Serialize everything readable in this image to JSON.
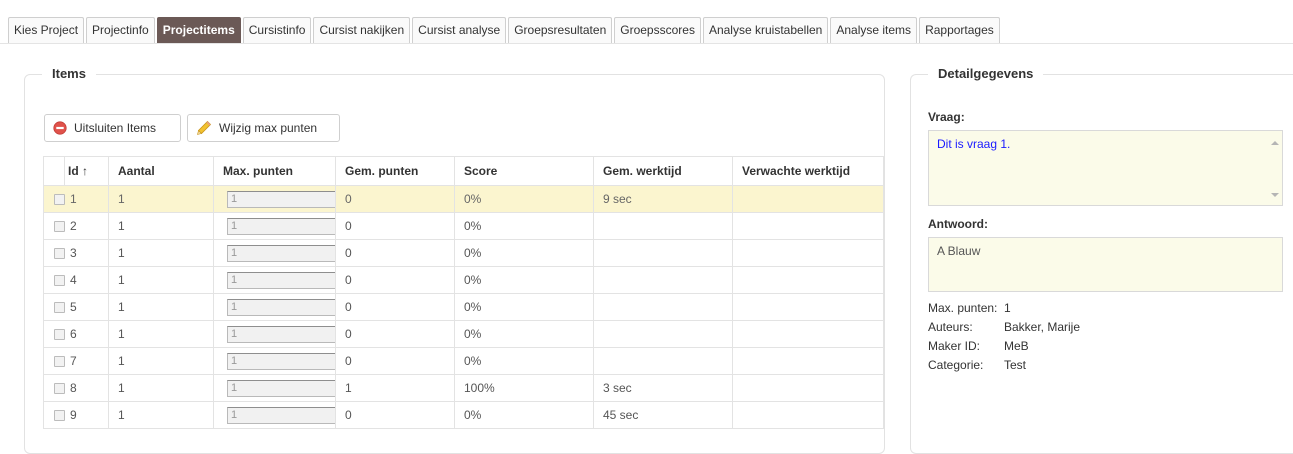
{
  "tabs": [
    {
      "label": "Kies Project"
    },
    {
      "label": "Projectinfo"
    },
    {
      "label": "Projectitems",
      "active": true
    },
    {
      "label": "Cursistinfo"
    },
    {
      "label": "Cursist nakijken"
    },
    {
      "label": "Cursist analyse"
    },
    {
      "label": "Groepsresultaten"
    },
    {
      "label": "Groepsscores"
    },
    {
      "label": "Analyse kruistabellen"
    },
    {
      "label": "Analyse items"
    },
    {
      "label": "Rapportages"
    }
  ],
  "items_panel": {
    "legend": "Items",
    "exclude_button": "Uitsluiten Items",
    "edit_max_button": "Wijzig max punten",
    "columns": [
      "Id ↑",
      "Aantal",
      "Max. punten",
      "Gem. punten",
      "Score",
      "Gem. werktijd",
      "Verwachte werktijd"
    ],
    "rows": [
      {
        "id": "1",
        "aantal": "1",
        "max": "1",
        "gem": "0",
        "score": "0%",
        "werktijd": "9 sec",
        "verwacht": ""
      },
      {
        "id": "2",
        "aantal": "1",
        "max": "1",
        "gem": "0",
        "score": "0%",
        "werktijd": "",
        "verwacht": ""
      },
      {
        "id": "3",
        "aantal": "1",
        "max": "1",
        "gem": "0",
        "score": "0%",
        "werktijd": "",
        "verwacht": ""
      },
      {
        "id": "4",
        "aantal": "1",
        "max": "1",
        "gem": "0",
        "score": "0%",
        "werktijd": "",
        "verwacht": ""
      },
      {
        "id": "5",
        "aantal": "1",
        "max": "1",
        "gem": "0",
        "score": "0%",
        "werktijd": "",
        "verwacht": ""
      },
      {
        "id": "6",
        "aantal": "1",
        "max": "1",
        "gem": "0",
        "score": "0%",
        "werktijd": "",
        "verwacht": ""
      },
      {
        "id": "7",
        "aantal": "1",
        "max": "1",
        "gem": "0",
        "score": "0%",
        "werktijd": "",
        "verwacht": ""
      },
      {
        "id": "8",
        "aantal": "1",
        "max": "1",
        "gem": "1",
        "score": "100%",
        "werktijd": "3 sec",
        "verwacht": ""
      },
      {
        "id": "9",
        "aantal": "1",
        "max": "1",
        "gem": "0",
        "score": "0%",
        "werktijd": "45 sec",
        "verwacht": ""
      }
    ],
    "selected_row": 0
  },
  "detail_panel": {
    "legend": "Detailgegevens",
    "question_label": "Vraag:",
    "question_text": "Dit is vraag 1.",
    "answer_label": "Antwoord:",
    "answer_text": "A Blauw",
    "meta": [
      {
        "key": "Max. punten:",
        "value": "1"
      },
      {
        "key": "Auteurs:",
        "value": "Bakker, Marije"
      },
      {
        "key": "Maker ID:",
        "value": "MeB"
      },
      {
        "key": "Categorie:",
        "value": "Test"
      }
    ]
  },
  "colors": {
    "active_tab": "#6b5956",
    "selected_row": "#fbf5cf",
    "question_text": "#1a1aff",
    "exclude_icon": "#e0524b",
    "edit_icon": "#e8b21d"
  },
  "icons": {
    "exclude": "minus-circle-icon",
    "edit": "pencil-icon",
    "sort": "arrow-up-icon"
  }
}
